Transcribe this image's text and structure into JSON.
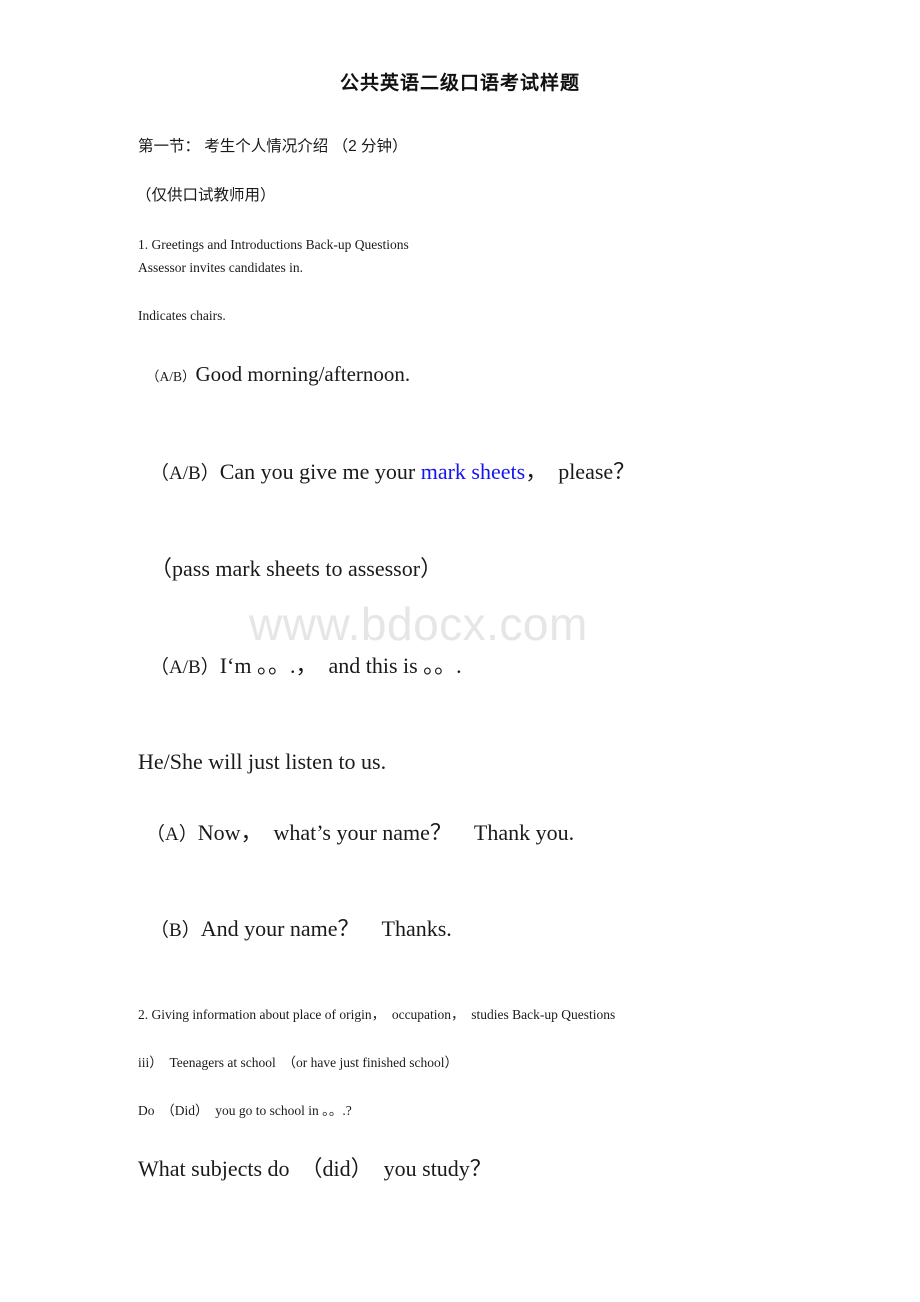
{
  "document": {
    "title": "公共英语二级口语考试样题",
    "watermark": "www.bdocx.com",
    "accent_link_color": "#1414f0",
    "watermark_color": "#e6e6e6",
    "text_color": "#1a1a1a",
    "background_color": "#ffffff"
  },
  "section_one": {
    "heading": "第一节： 考生个人情况介绍 （2 分钟）",
    "note": "（仅供口试教师用）",
    "item1_title": "1. Greetings and Introductions Back-up Questions",
    "item1_line2": "Assessor invites candidates in.",
    "indicates_chairs": "Indicates chairs."
  },
  "dialogue": {
    "greeting": {
      "tag": "（A/B）",
      "text": "Good morning/afternoon."
    },
    "mark_sheets": {
      "tag": "（A/B）",
      "before": "Can you give me your ",
      "link": "mark sheets",
      "after": "，　please？"
    },
    "stage_direction": "（pass mark sheets to assessor）",
    "introduction": {
      "tag": "（A/B）",
      "text": "I‘m 。。.，　and this is 。。."
    },
    "listen": "He/She will just listen to us.",
    "name_a": {
      "tag": "（A）",
      "text": "Now，　what’s your name？　Thank you."
    },
    "name_b": {
      "tag": "（B）",
      "text": "And your name？　Thanks."
    }
  },
  "section_two": {
    "item2_title": "2. Giving information about place of origin，　occupation，　studies Back-up Questions",
    "subitem_iii": "iii）　Teenagers at school　（or have just finished school）",
    "question_do": "Do　（Did）　you go to school in 。。.?",
    "question_subjects": "What subjects do　（did）　you study？"
  }
}
